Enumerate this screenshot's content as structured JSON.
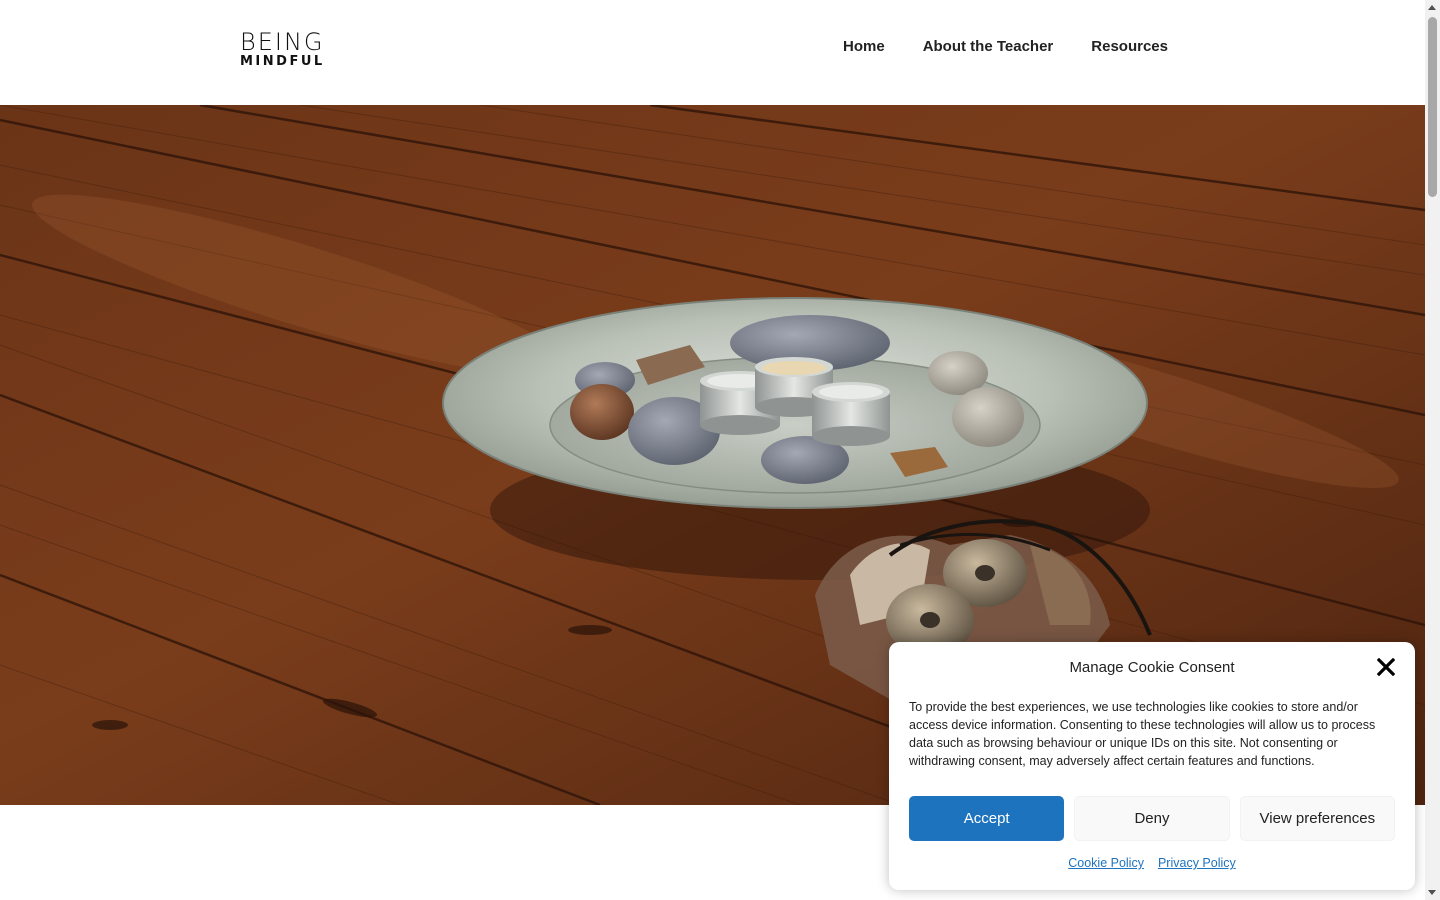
{
  "header": {
    "logo": {
      "line1": "BEING",
      "line2": "MINDFUL"
    },
    "nav": [
      {
        "label": "Home"
      },
      {
        "label": "About the Teacher"
      },
      {
        "label": "Resources"
      }
    ]
  },
  "hero": {
    "image_subject": "meditation-plate-with-stones-candles-and-tingsha-on-wooden-floor"
  },
  "cookie_dialog": {
    "title": "Manage Cookie Consent",
    "text": "To provide the best experiences, we use technologies like cookies to store and/or access device information. Consenting to these technologies will allow us to process data such as browsing behaviour or unique IDs on this site. Not consenting or withdrawing consent, may adversely affect certain features and functions.",
    "accept_label": "Accept",
    "deny_label": "Deny",
    "preferences_label": "View preferences",
    "cookie_policy_label": "Cookie Policy",
    "privacy_policy_label": "Privacy Policy",
    "accent_color": "#1e73be"
  }
}
